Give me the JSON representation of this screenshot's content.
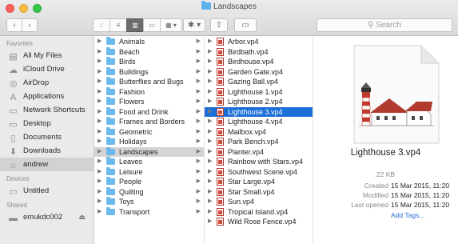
{
  "window": {
    "title": "Landscapes"
  },
  "toolbar": {
    "back_glyph": "‹",
    "forward_glyph": "›",
    "views": [
      "::",
      "≡",
      "▥",
      "▭"
    ],
    "arrange_glyph": "▦ ▾",
    "action_glyph": "✱ ▾",
    "share_glyph": "⇧",
    "tag_glyph": "▭"
  },
  "search": {
    "placeholder": "Search",
    "icon": "search-icon"
  },
  "sidebar": {
    "favorites_heading": "Favorites",
    "favorites": [
      {
        "label": "All My Files",
        "icon": "all-files-icon",
        "glyph": "▤"
      },
      {
        "label": "iCloud Drive",
        "icon": "cloud-icon",
        "glyph": "☁"
      },
      {
        "label": "AirDrop",
        "icon": "airdrop-icon",
        "glyph": "◎"
      },
      {
        "label": "Applications",
        "icon": "applications-icon",
        "glyph": "A"
      },
      {
        "label": "Network Shortcuts",
        "icon": "folder-icon",
        "glyph": "▭"
      },
      {
        "label": "Desktop",
        "icon": "desktop-icon",
        "glyph": "▭"
      },
      {
        "label": "Documents",
        "icon": "documents-icon",
        "glyph": "▯"
      },
      {
        "label": "Downloads",
        "icon": "downloads-icon",
        "glyph": "⬇"
      },
      {
        "label": "andrew",
        "icon": "home-icon",
        "glyph": "⌂"
      }
    ],
    "devices_heading": "Devices",
    "devices": [
      {
        "label": "Untitled",
        "icon": "disk-icon",
        "glyph": "▭"
      }
    ],
    "shared_heading": "Shared",
    "shared": [
      {
        "label": "emukdc002",
        "icon": "computer-icon",
        "glyph": "▬",
        "eject": "⏏"
      }
    ]
  },
  "column1": {
    "items": [
      "Animals",
      "Beach",
      "Birds",
      "Buildings",
      "Butterflies and Bugs",
      "Fashion",
      "Flowers",
      "Food and Drink",
      "Frames and Borders",
      "Geometric",
      "Holidays",
      "Landscapes",
      "Leaves",
      "Leisure",
      "People",
      "Quilting",
      "Toys",
      "Transport"
    ],
    "selected": "Landscapes"
  },
  "column2": {
    "items": [
      "Arbor.vp4",
      "Birdbath.vp4",
      "Birdhouse.vp4",
      "Garden Gate.vp4",
      "Gazing Ball.vp4",
      "Lighthouse 1.vp4",
      "Lighthouse 2.vp4",
      "Lighthouse 3.vp4",
      "Lighthouse 4.vp4",
      "Mailbox.vp4",
      "Park Bench.vp4",
      "Planter.vp4",
      "Rainbow with Stars.vp4",
      "Southwest Scene.vp4",
      "Star Large.vp4",
      "Star Small.vp4",
      "Sun.vp4",
      "Tropical Island.vp4",
      "Wild Rose Fence.vp4"
    ],
    "selected": "Lighthouse 3.vp4"
  },
  "preview": {
    "name": "Lighthouse 3.vp4",
    "size": "22 KB",
    "meta": [
      {
        "key": "Created",
        "value": "15 Mar 2015, 11:20"
      },
      {
        "key": "Modified",
        "value": "15 Mar 2015, 11:20"
      },
      {
        "key": "Last opened",
        "value": "15 Mar 2015, 11:20"
      }
    ],
    "add_tags": "Add Tags..."
  },
  "colors": {
    "selection": "#1d6fd8",
    "folder": "#6cb9ee",
    "link": "#2a6fd6"
  }
}
